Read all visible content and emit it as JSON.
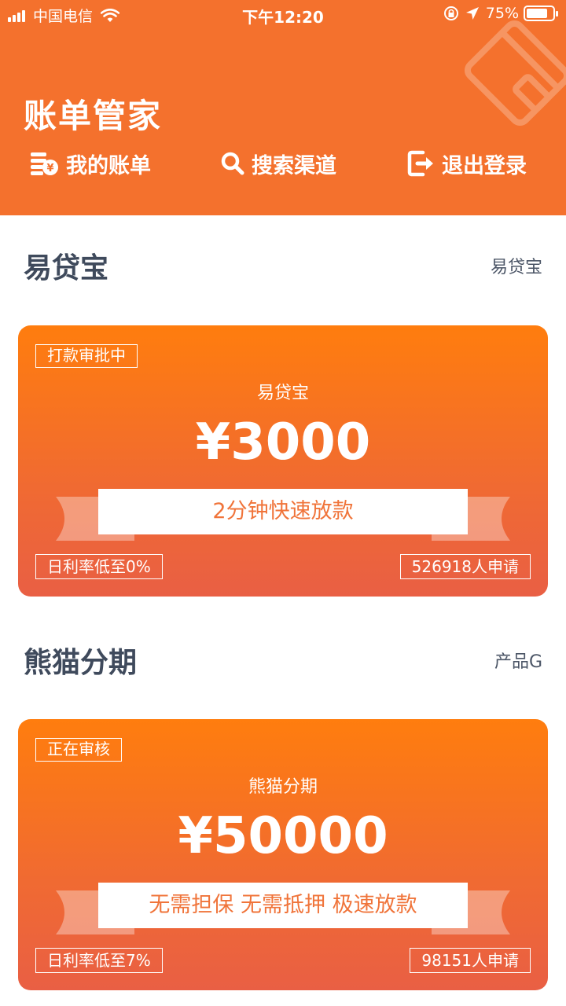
{
  "status_bar": {
    "carrier": "中国电信",
    "time": "下午12:20",
    "battery": "75%",
    "battery_level": 0.75
  },
  "header": {
    "title": "账单管家",
    "background_color": "#f4712d",
    "nav": [
      {
        "label": "我的账单",
        "icon": "bill-coins-icon"
      },
      {
        "label": "搜索渠道",
        "icon": "search-icon"
      },
      {
        "label": "退出登录",
        "icon": "logout-icon"
      }
    ]
  },
  "sections": [
    {
      "title": "易贷宝",
      "subtitle": "易贷宝",
      "card": {
        "status": "打款审批中",
        "name": "易贷宝",
        "amount": "¥3000",
        "ribbon": "2分钟快速放款",
        "rate": "日利率低至0%",
        "applicants": "526918人申请"
      }
    },
    {
      "title": "熊猫分期",
      "subtitle": "产品G",
      "card": {
        "status": "正在审核",
        "name": "熊猫分期",
        "amount": "¥50000",
        "ribbon": "无需担保 无需抵押 极速放款",
        "rate": "日利率低至7%",
        "applicants": "98151人申请"
      }
    }
  ],
  "colors": {
    "accent": "#f4712d",
    "card_top": "#ff7d0e",
    "card_bottom": "#e95f44",
    "section_title": "#3f4a5c"
  }
}
